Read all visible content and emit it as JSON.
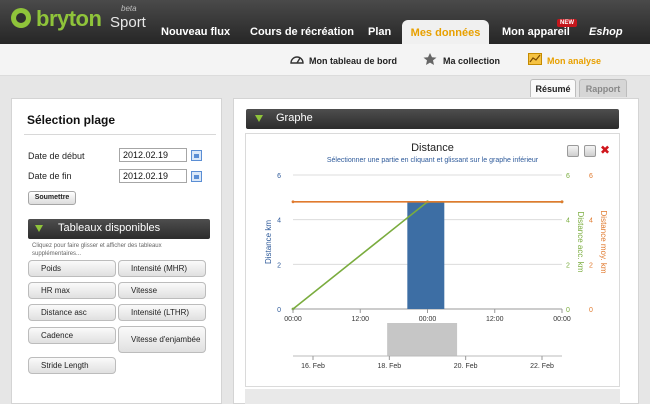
{
  "brand": {
    "name": "bryton",
    "product": "Sport",
    "badge": "beta"
  },
  "nav": {
    "items": [
      "Nouveau flux",
      "Cours de récréation",
      "Plan",
      "Mes données",
      "Mon appareil",
      "Eshop"
    ],
    "active": "Mes données",
    "new_badge": "NEW"
  },
  "subnav": {
    "items": [
      "Mon tableau de bord",
      "Ma collection",
      "Mon analyse"
    ],
    "active": "Mon analyse"
  },
  "tabs": {
    "resume": "Résumé",
    "rapport": "Rapport"
  },
  "selection": {
    "title": "Sélection plage",
    "start_label": "Date de début",
    "start_value": "2012.02.19",
    "end_label": "Date de fin",
    "end_value": "2012.02.19",
    "submit_label": "Soumettre"
  },
  "tables": {
    "title": "Tableaux disponibles",
    "hint": "Cliquez pour faire glisser et afficher des tableaux supplémentaires...",
    "items": [
      "Poids",
      "Intensité (MHR)",
      "HR max",
      "Vitesse",
      "Distance asc",
      "Intensité (LTHR)",
      "Cadence",
      "Vitesse d'enjambée",
      "Stride Length"
    ]
  },
  "graph": {
    "header": "Graphe"
  },
  "colors": {
    "accent": "#8fc43a",
    "active": "#e8a000",
    "bar": "#3d6ea4",
    "line_green": "#7aac3e",
    "line_orange": "#e07a2e",
    "close": "#d0161c"
  },
  "chart_data": {
    "type": "bar",
    "title": "Distance",
    "subtitle": "Sélectionner une partie en cliquant et glissant sur le graphe inférieur",
    "ylabel_left": "Distance km",
    "ylabel_right_1": "Distance acc. km",
    "ylabel_right_2": "Distance moy. km",
    "x_ticks": [
      "00:00",
      "12:00",
      "00:00",
      "12:00",
      "00:00"
    ],
    "y_left_ticks": [
      "0",
      "2",
      "4",
      "6"
    ],
    "y_right1_ticks": [
      "0",
      "2",
      "4",
      "6"
    ],
    "y_right2_ticks": [
      "0",
      "2",
      "4",
      "6"
    ],
    "ylim": [
      0,
      6
    ],
    "xlim": [
      0,
      4
    ],
    "bar": {
      "x_start": 1.7,
      "x_end": 2.25,
      "value": 4.8
    },
    "series": [
      {
        "name": "Distance acc. km",
        "points": [
          [
            0,
            0
          ],
          [
            2,
            4.8
          ],
          [
            4,
            4.8
          ]
        ]
      },
      {
        "name": "Distance moy. km",
        "points": [
          [
            0,
            4.8
          ],
          [
            4,
            4.8
          ]
        ]
      }
    ],
    "navigator": {
      "x_ticks": [
        "16. Feb",
        "18. Feb",
        "20. Feb",
        "22. Feb"
      ],
      "selection": [
        0.35,
        0.61
      ]
    }
  }
}
